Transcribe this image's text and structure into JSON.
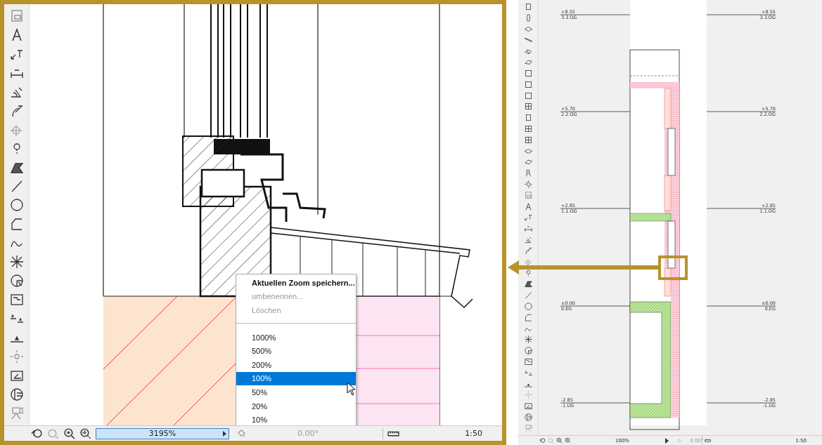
{
  "detail_view": {
    "zoom_menu": {
      "commands": [
        {
          "label": "Aktuellen Zoom speichern...",
          "disabled": false
        },
        {
          "label": "umbenennen...",
          "disabled": true
        },
        {
          "label": "Löschen",
          "disabled": true
        }
      ],
      "presets": [
        {
          "label": "1000%",
          "selected": false
        },
        {
          "label": "500%",
          "selected": false
        },
        {
          "label": "200%",
          "selected": false
        },
        {
          "label": "100%",
          "selected": true
        },
        {
          "label": "50%",
          "selected": false
        },
        {
          "label": "20%",
          "selected": false
        },
        {
          "label": "10%",
          "selected": false
        }
      ]
    },
    "status_bar": {
      "zoom": "3195%",
      "angle": "0.00°",
      "scale": "1:50"
    }
  },
  "overview": {
    "levels": [
      {
        "left": {
          "elevation": "+8.55",
          "name": "3.3.OG"
        },
        "right": {
          "elevation": "+8.55",
          "name": "3.3.OG"
        }
      },
      {
        "left": {
          "elevation": "+5.70",
          "name": "2.2.OG"
        },
        "right": {
          "elevation": "+5.70",
          "name": "2.2.OG"
        }
      },
      {
        "left": {
          "elevation": "+2.85",
          "name": "1.1.OG"
        },
        "right": {
          "elevation": "+2.85",
          "name": "1.1.OG"
        }
      },
      {
        "left": {
          "elevation": "±0.00",
          "name": "0.EG"
        },
        "right": {
          "elevation": "±0.00",
          "name": "0.EG"
        }
      },
      {
        "left": {
          "elevation": "-2.85",
          "name": "-1.UG"
        },
        "right": {
          "elevation": "-2.85",
          "name": "-1.UG"
        }
      }
    ],
    "status_bar": {
      "zoom": "100%",
      "angle": "0.00°",
      "scale": "1:50"
    }
  }
}
